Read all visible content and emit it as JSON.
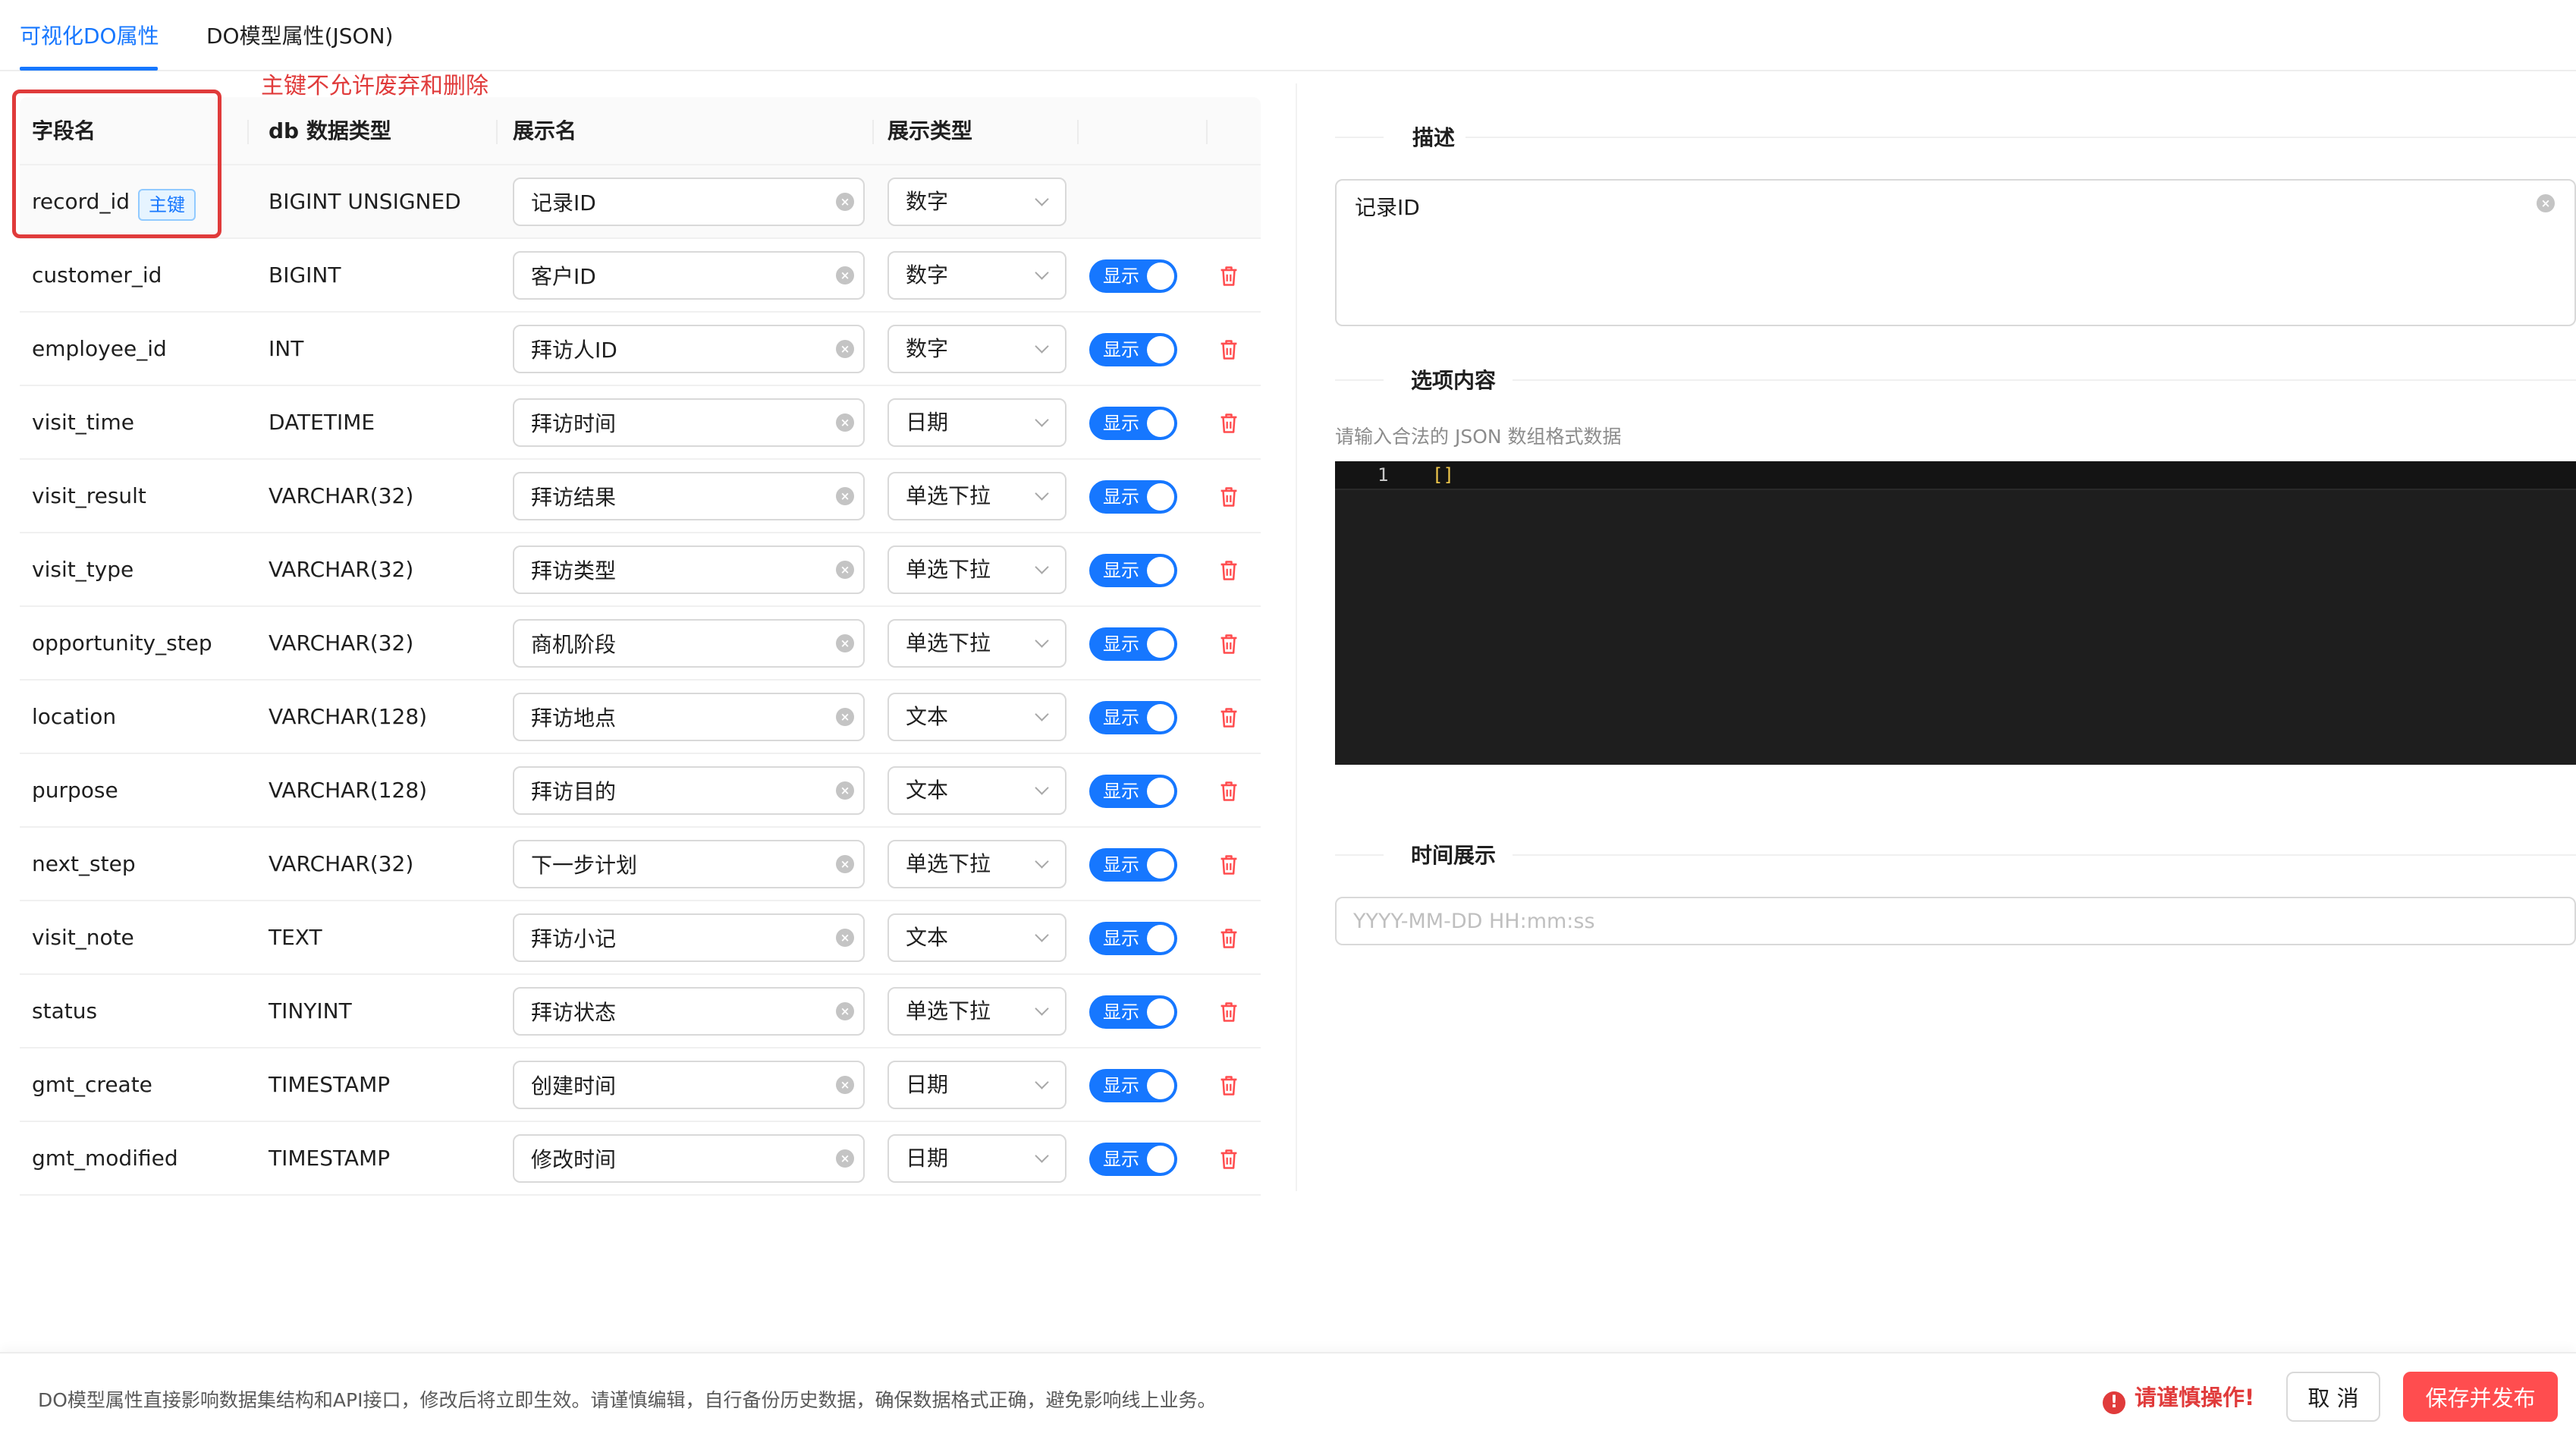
{
  "tabs": [
    {
      "label": "可视化DO属性",
      "active": true
    },
    {
      "label": "DO模型属性(JSON)",
      "active": false
    }
  ],
  "annotation": {
    "note": "主键不允许废弃和删除",
    "color": "#e03b3b"
  },
  "table": {
    "headers": {
      "field": "字段名",
      "db_type": "db 数据类型",
      "display_name": "展示名",
      "display_type": "展示类型"
    },
    "primary_tag": "主键",
    "switch_label": "显示",
    "rows": [
      {
        "field": "record_id",
        "db_type": "BIGINT UNSIGNED",
        "display_name": "记录ID",
        "display_type": "数字",
        "primary": true
      },
      {
        "field": "customer_id",
        "db_type": "BIGINT",
        "display_name": "客户ID",
        "display_type": "数字",
        "visible": true
      },
      {
        "field": "employee_id",
        "db_type": "INT",
        "display_name": "拜访人ID",
        "display_type": "数字",
        "visible": true
      },
      {
        "field": "visit_time",
        "db_type": "DATETIME",
        "display_name": "拜访时间",
        "display_type": "日期",
        "visible": true
      },
      {
        "field": "visit_result",
        "db_type": "VARCHAR(32)",
        "display_name": "拜访结果",
        "display_type": "单选下拉",
        "visible": true
      },
      {
        "field": "visit_type",
        "db_type": "VARCHAR(32)",
        "display_name": "拜访类型",
        "display_type": "单选下拉",
        "visible": true
      },
      {
        "field": "opportunity_step",
        "db_type": "VARCHAR(32)",
        "display_name": "商机阶段",
        "display_type": "单选下拉",
        "visible": true
      },
      {
        "field": "location",
        "db_type": "VARCHAR(128)",
        "display_name": "拜访地点",
        "display_type": "文本",
        "visible": true
      },
      {
        "field": "purpose",
        "db_type": "VARCHAR(128)",
        "display_name": "拜访目的",
        "display_type": "文本",
        "visible": true
      },
      {
        "field": "next_step",
        "db_type": "VARCHAR(32)",
        "display_name": "下一步计划",
        "display_type": "单选下拉",
        "visible": true
      },
      {
        "field": "visit_note",
        "db_type": "TEXT",
        "display_name": "拜访小记",
        "display_type": "文本",
        "visible": true
      },
      {
        "field": "status",
        "db_type": "TINYINT",
        "display_name": "拜访状态",
        "display_type": "单选下拉",
        "visible": true
      },
      {
        "field": "gmt_create",
        "db_type": "TIMESTAMP",
        "display_name": "创建时间",
        "display_type": "日期",
        "visible": true
      },
      {
        "field": "gmt_modified",
        "db_type": "TIMESTAMP",
        "display_name": "修改时间",
        "display_type": "日期",
        "visible": true
      }
    ]
  },
  "detail": {
    "description_title": "描述",
    "description_value": "记录ID",
    "options_title": "选项内容",
    "options_hint": "请输入合法的 JSON 数组格式数据",
    "editor": {
      "line_number": "1",
      "code": "[]"
    },
    "time_title": "时间展示",
    "time_placeholder": "YYYY-MM-DD HH:mm:ss"
  },
  "footer": {
    "notice": "DO模型属性直接影响数据集结构和API接口，修改后将立即生效。请谨慎编辑，自行备份历史数据，确保数据格式正确，避免影响线上业务。",
    "warning": "请谨慎操作!",
    "cancel_label": "取 消",
    "save_label": "保存并发布"
  },
  "colors": {
    "accent": "#1677ff",
    "danger": "#ff4d4f",
    "editor_bg": "#1e1e1e"
  },
  "icons": {
    "clear": "clear-circle-icon",
    "dropdown": "chevron-down-icon",
    "delete": "trash-icon",
    "warning": "exclamation-circle-icon"
  }
}
